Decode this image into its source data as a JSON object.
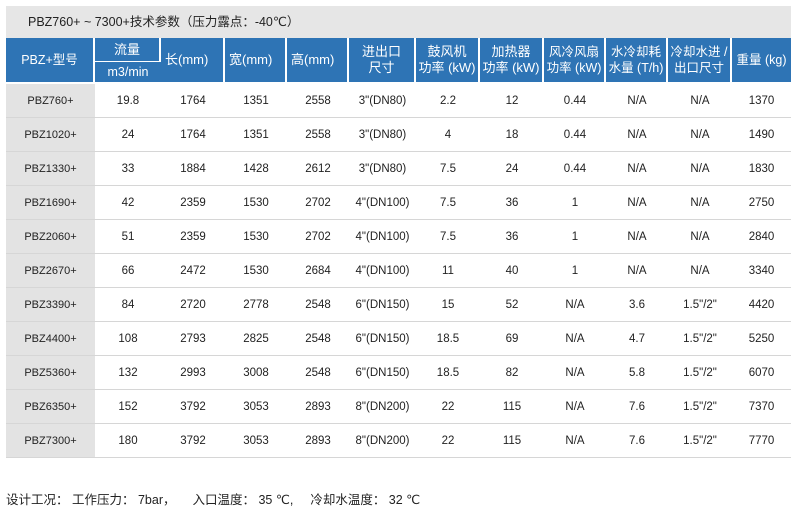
{
  "title": "PBZ760+ ~ 7300+技术参数（压力露点：-40℃）",
  "headers": {
    "model": "PBZ+型号",
    "flow_top": "流量",
    "flow_unit": "m3/min",
    "length": "长(mm)",
    "width": "宽(mm)",
    "height": "高(mm)",
    "port_1": "进出口",
    "port_2": "尺寸",
    "blower_1": "鼓风机",
    "blower_2": "功率 (kW)",
    "heater_1": "加热器",
    "heater_2": "功率 (kW)",
    "fan_1": "风冷风扇",
    "fan_2": "功率 (kW)",
    "water_1": "水冷却耗",
    "water_2": "水量 (T/h)",
    "cw_1": "冷却水进 /",
    "cw_2": "出口尺寸",
    "weight": "重量 (kg)"
  },
  "rows": [
    [
      "PBZ760+",
      "19.8",
      "1764",
      "1351",
      "2558",
      "3\"(DN80)",
      "2.2",
      "12",
      "0.44",
      "N/A",
      "N/A",
      "1370"
    ],
    [
      "PBZ1020+",
      "24",
      "1764",
      "1351",
      "2558",
      "3\"(DN80)",
      "4",
      "18",
      "0.44",
      "N/A",
      "N/A",
      "1490"
    ],
    [
      "PBZ1330+",
      "33",
      "1884",
      "1428",
      "2612",
      "3\"(DN80)",
      "7.5",
      "24",
      "0.44",
      "N/A",
      "N/A",
      "1830"
    ],
    [
      "PBZ1690+",
      "42",
      "2359",
      "1530",
      "2702",
      "4\"(DN100)",
      "7.5",
      "36",
      "1",
      "N/A",
      "N/A",
      "2750"
    ],
    [
      "PBZ2060+",
      "51",
      "2359",
      "1530",
      "2702",
      "4\"(DN100)",
      "7.5",
      "36",
      "1",
      "N/A",
      "N/A",
      "2840"
    ],
    [
      "PBZ2670+",
      "66",
      "2472",
      "1530",
      "2684",
      "4\"(DN100)",
      "11",
      "40",
      "1",
      "N/A",
      "N/A",
      "3340"
    ],
    [
      "PBZ3390+",
      "84",
      "2720",
      "2778",
      "2548",
      "6\"(DN150)",
      "15",
      "52",
      "N/A",
      "3.6",
      "1.5\"/2\"",
      "4420"
    ],
    [
      "PBZ4400+",
      "108",
      "2793",
      "2825",
      "2548",
      "6\"(DN150)",
      "18.5",
      "69",
      "N/A",
      "4.7",
      "1.5\"/2\"",
      "5250"
    ],
    [
      "PBZ5360+",
      "132",
      "2993",
      "3008",
      "2548",
      "6\"(DN150)",
      "18.5",
      "82",
      "N/A",
      "5.8",
      "1.5\"/2\"",
      "6070"
    ],
    [
      "PBZ6350+",
      "152",
      "3792",
      "3053",
      "2893",
      "8\"(DN200)",
      "22",
      "115",
      "N/A",
      "7.6",
      "1.5\"/2\"",
      "7370"
    ],
    [
      "PBZ7300+",
      "180",
      "3792",
      "3053",
      "2893",
      "8\"(DN200)",
      "22",
      "115",
      "N/A",
      "7.6",
      "1.5\"/2\"",
      "7770"
    ]
  ],
  "footnote": {
    "label": "设计工况：",
    "pressure": "工作压力： 7bar，",
    "inlet_temp": "入口温度： 35 ℃,",
    "water_temp": "冷却水温度： 32 ℃"
  },
  "colors": {
    "header_bg": "#2e74b5",
    "title_bg": "#e6e6e6",
    "model_cell_bg": "#e3e3e3"
  }
}
